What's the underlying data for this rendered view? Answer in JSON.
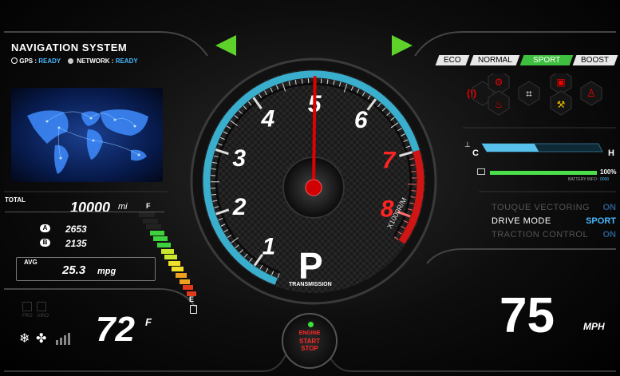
{
  "nav": {
    "title": "NAVIGATION SYSTEM",
    "gps_label": "GPS :",
    "gps_value": "READY",
    "network_label": "NETWORK :",
    "network_value": "READY"
  },
  "odometer": {
    "total_label": "TOTAL",
    "total_value": "10000",
    "total_unit": "mi",
    "trip_a_label": "A",
    "trip_a_value": "2653",
    "trip_b_label": "B",
    "trip_b_value": "2135",
    "avg_label": "AVG",
    "avg_value": "25.3",
    "avg_unit": "mpg"
  },
  "fuel": {
    "full_label": "F",
    "empty_label": "E",
    "level": 0.82
  },
  "climate": {
    "temperature": "72",
    "unit": "F",
    "indicators": [
      "FRO",
      "AIRO"
    ]
  },
  "tachometer": {
    "ticks": [
      "1",
      "2",
      "3",
      "4",
      "5",
      "6",
      "7",
      "8"
    ],
    "redline_start": 7,
    "current_rpm": 5,
    "unit_label": "X1000R/M",
    "gear": "P",
    "gear_label": "TRANSMISSION"
  },
  "start_button": {
    "line1": "ENGINE",
    "line2": "START",
    "line3": "STOP"
  },
  "drive_modes": {
    "tabs": [
      "ECO",
      "NORMAL",
      "SPORT",
      "BOOST"
    ],
    "active": "SPORT"
  },
  "temp_gauge": {
    "cold_label": "C",
    "hot_label": "H",
    "level": 0.45
  },
  "battery": {
    "percent": "100%",
    "info_label": "BATTERY INFO :",
    "info_value": "0000",
    "level": 1.0
  },
  "vehicle_status": [
    {
      "label": "TOUQUE VECTORING",
      "value": "ON"
    },
    {
      "label": "DRIVE MODE",
      "value": "SPORT"
    },
    {
      "label": "TRACTION CONTROL",
      "value": "ON"
    }
  ],
  "speed": {
    "value": "75",
    "unit": "MPH"
  },
  "colors": {
    "accent_green": "#5ed12a",
    "accent_blue": "#49b8ff",
    "needle_red": "#e10000",
    "tach_teal": "#3aaecd"
  }
}
